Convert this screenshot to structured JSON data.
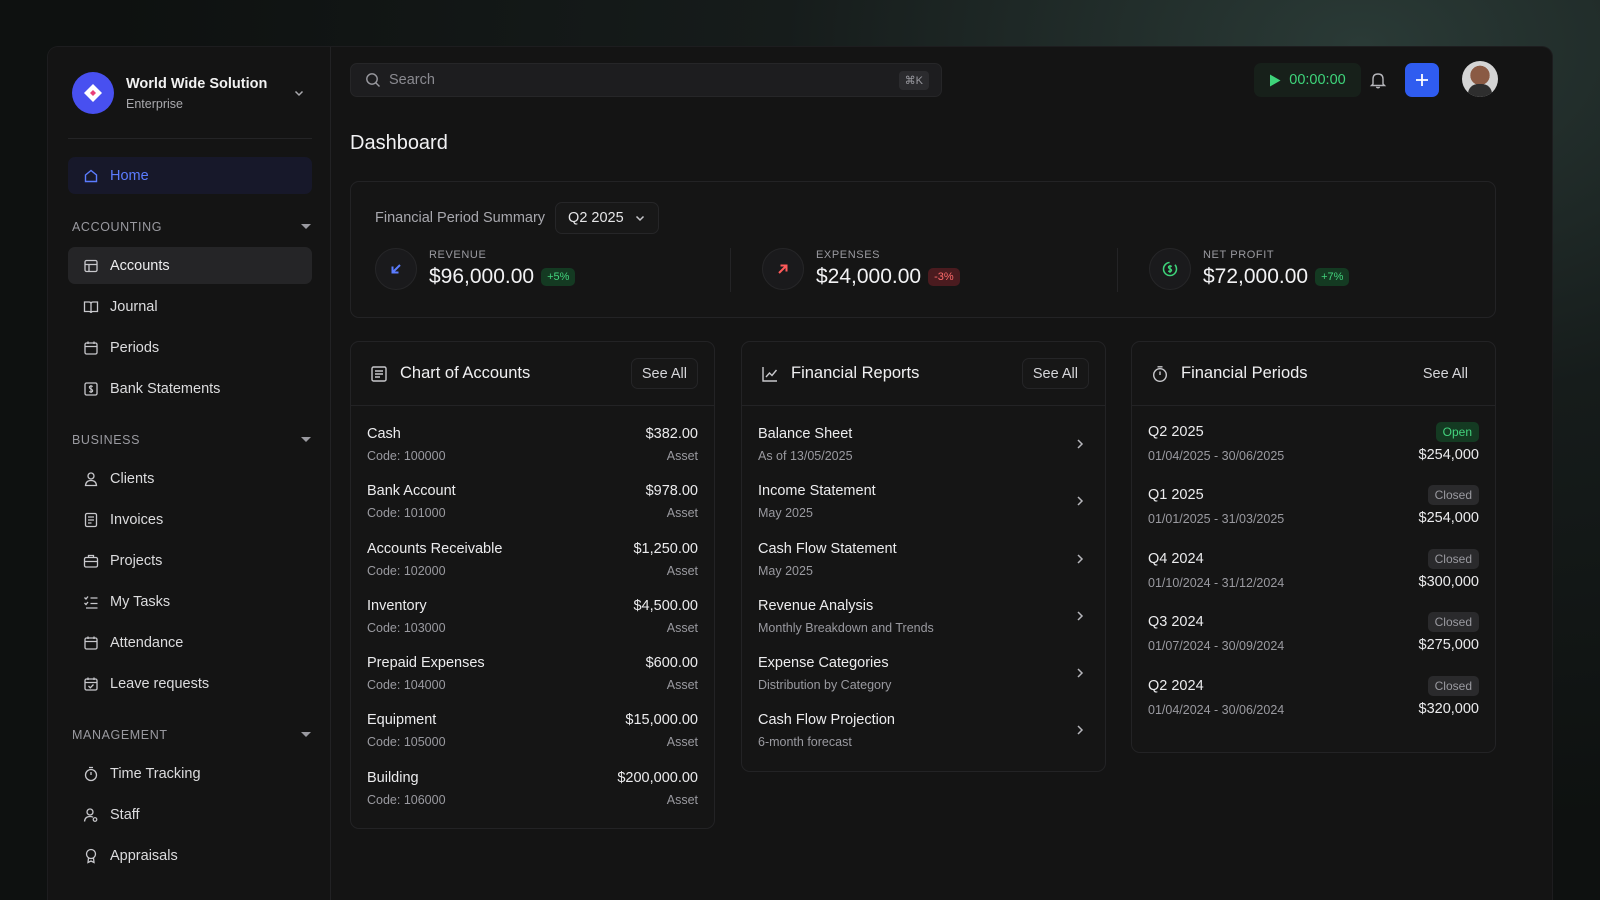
{
  "org": {
    "name": "World Wide Solution",
    "plan": "Enterprise"
  },
  "nav": {
    "home": "Home",
    "sections": [
      {
        "title": "ACCOUNTING",
        "items": [
          "Accounts",
          "Journal",
          "Periods",
          "Bank Statements"
        ]
      },
      {
        "title": "BUSINESS",
        "items": [
          "Clients",
          "Invoices",
          "Projects",
          "My Tasks",
          "Attendance",
          "Leave requests"
        ]
      },
      {
        "title": "MANAGEMENT",
        "items": [
          "Time Tracking",
          "Staff",
          "Appraisals"
        ]
      }
    ]
  },
  "topbar": {
    "search_placeholder": "Search",
    "search_shortcut": "⌘K",
    "timer": "00:00:00"
  },
  "page": {
    "title": "Dashboard"
  },
  "summary": {
    "label": "Financial Period Summary",
    "period": "Q2 2025",
    "metrics": [
      {
        "label": "REVENUE",
        "value": "$96,000.00",
        "change": "+5%",
        "trend": "up",
        "color": "#5b7cff"
      },
      {
        "label": "EXPENSES",
        "value": "$24,000.00",
        "change": "-3%",
        "trend": "down",
        "color": "#ff5a5a"
      },
      {
        "label": "NET PROFIT",
        "value": "$72,000.00",
        "change": "+7%",
        "trend": "up",
        "color": "#3ed47a"
      }
    ]
  },
  "chart_of_accounts": {
    "title": "Chart of Accounts",
    "see_all": "See All",
    "rows": [
      {
        "name": "Cash",
        "code": "Code: 100000",
        "amount": "$382.00",
        "type": "Asset"
      },
      {
        "name": "Bank Account",
        "code": "Code: 101000",
        "amount": "$978.00",
        "type": "Asset"
      },
      {
        "name": "Accounts Receivable",
        "code": "Code: 102000",
        "amount": "$1,250.00",
        "type": "Asset"
      },
      {
        "name": "Inventory",
        "code": "Code: 103000",
        "amount": "$4,500.00",
        "type": "Asset"
      },
      {
        "name": "Prepaid Expenses",
        "code": "Code: 104000",
        "amount": "$600.00",
        "type": "Asset"
      },
      {
        "name": "Equipment",
        "code": "Code: 105000",
        "amount": "$15,000.00",
        "type": "Asset"
      },
      {
        "name": "Building",
        "code": "Code: 106000",
        "amount": "$200,000.00",
        "type": "Asset"
      }
    ]
  },
  "financial_reports": {
    "title": "Financial Reports",
    "see_all": "See All",
    "rows": [
      {
        "name": "Balance Sheet",
        "sub": "As of 13/05/2025"
      },
      {
        "name": "Income Statement",
        "sub": "May 2025"
      },
      {
        "name": "Cash Flow Statement",
        "sub": "May 2025"
      },
      {
        "name": "Revenue Analysis",
        "sub": "Monthly Breakdown and Trends"
      },
      {
        "name": "Expense Categories",
        "sub": "Distribution by Category"
      },
      {
        "name": "Cash Flow Projection",
        "sub": "6-month forecast"
      }
    ]
  },
  "financial_periods": {
    "title": "Financial Periods",
    "see_all": "See All",
    "rows": [
      {
        "name": "Q2 2025",
        "dates": "01/04/2025 - 30/06/2025",
        "status": "Open",
        "amount": "$254,000"
      },
      {
        "name": "Q1 2025",
        "dates": "01/01/2025 - 31/03/2025",
        "status": "Closed",
        "amount": "$254,000"
      },
      {
        "name": "Q4 2024",
        "dates": "01/10/2024 - 31/12/2024",
        "status": "Closed",
        "amount": "$300,000"
      },
      {
        "name": "Q3 2024",
        "dates": "01/07/2024 - 30/09/2024",
        "status": "Closed",
        "amount": "$275,000"
      },
      {
        "name": "Q2 2024",
        "dates": "01/04/2024 - 30/06/2024",
        "status": "Closed",
        "amount": "$320,000"
      }
    ]
  }
}
